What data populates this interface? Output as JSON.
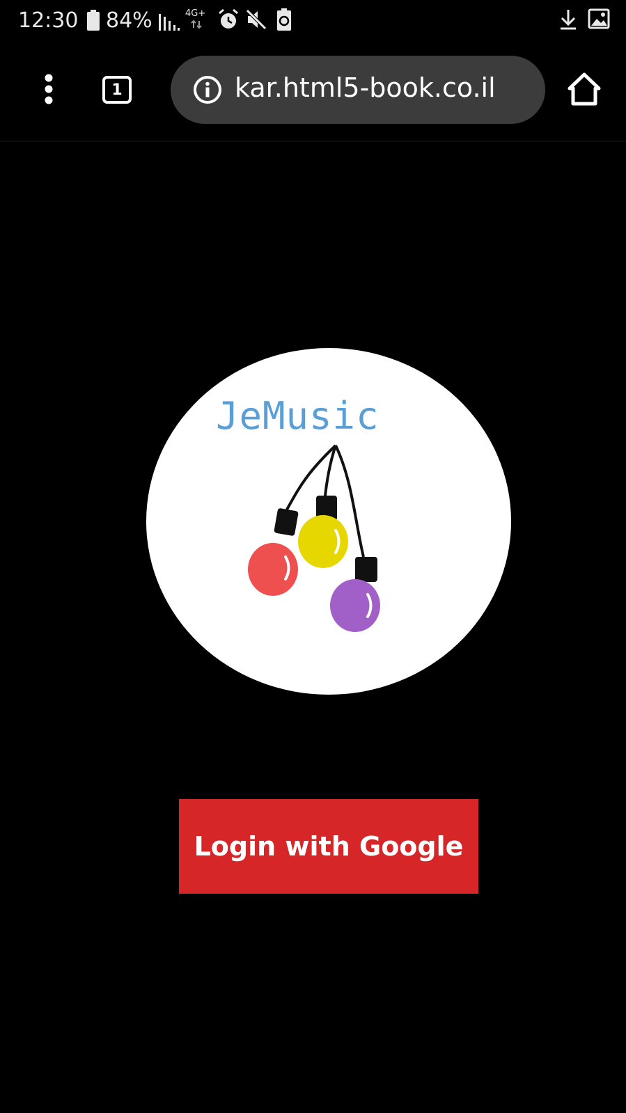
{
  "status_bar": {
    "time": "12:30",
    "battery_percent": "84%",
    "network_type": "4G+",
    "icons": [
      "battery-icon",
      "signal-icon",
      "network-icon",
      "alarm-icon",
      "mute-icon",
      "battery-saver-icon",
      "download-icon",
      "image-icon"
    ]
  },
  "browser": {
    "tab_count": "1",
    "url": "kar.html5-book.co.il",
    "icons": [
      "menu-icon",
      "tabs-icon",
      "info-icon",
      "home-icon"
    ]
  },
  "app": {
    "logo_text": "JeMusic",
    "login_label": "Login with Google",
    "colors": {
      "background": "#000000",
      "login_button": "#d62627",
      "logo_text": "#5a9ed8",
      "bulb_red": "#ee5050",
      "bulb_yellow": "#e6d700",
      "bulb_purple": "#a060c8"
    }
  }
}
